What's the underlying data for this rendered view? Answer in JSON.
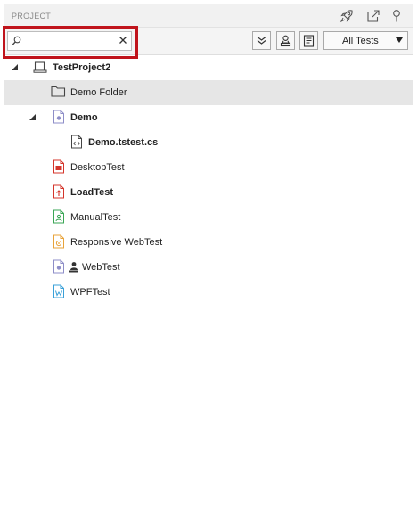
{
  "panel": {
    "title": "PROJECT"
  },
  "search": {
    "value": "",
    "placeholder": ""
  },
  "filter": {
    "selected": "All Tests"
  },
  "tree": {
    "project": "TestProject2",
    "demo_folder": "Demo Folder",
    "demo": "Demo",
    "demo_file": "Demo.tstest.cs",
    "desktop_test": "DesktopTest",
    "load_test": "LoadTest",
    "manual_test": "ManualTest",
    "responsive_web_test": "Responsive WebTest",
    "web_test": "WebTest",
    "wpf_test": "WPFTest"
  },
  "colors": {
    "highlight_border": "#c0141c",
    "desktop_icon": "#d4352b",
    "load_icon": "#d4352b",
    "manual_icon": "#3aa655",
    "responsive_icon": "#e8a33a",
    "wpf_icon": "#3aa0d8",
    "web_icon": "#8e8ec8",
    "selected_row": "#e6e6e6"
  }
}
